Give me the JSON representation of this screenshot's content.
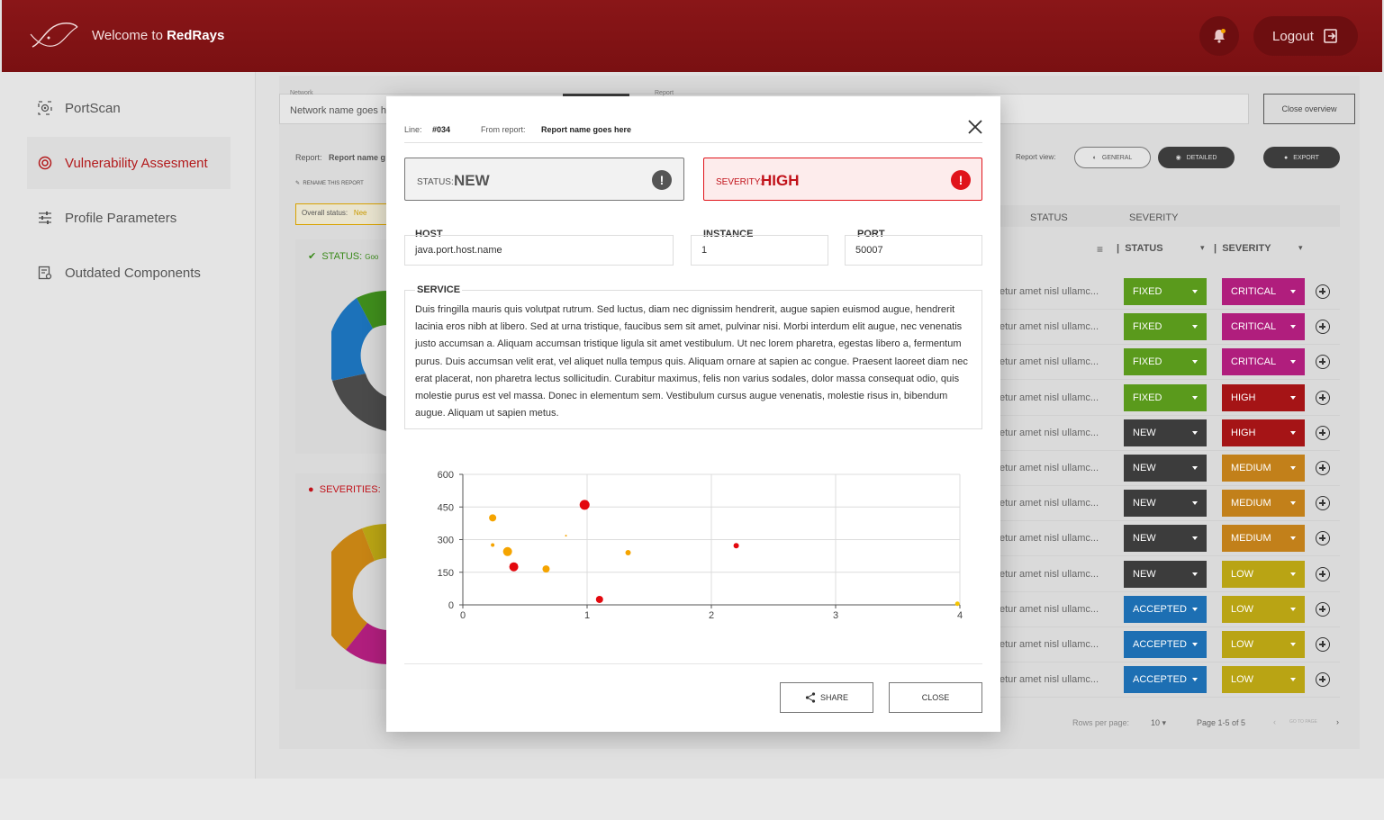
{
  "header": {
    "welcome_prefix": "Welcome to ",
    "brand": "RedRays",
    "logout_label": "Logout"
  },
  "sidebar": {
    "items": [
      {
        "label": "PortScan",
        "icon": "radar-icon",
        "active": false
      },
      {
        "label": "Vulnerability Assesment",
        "icon": "target-icon",
        "active": true
      },
      {
        "label": "Profile Parameters",
        "icon": "sliders-icon",
        "active": false
      },
      {
        "label": "Outdated Components",
        "icon": "components-icon",
        "active": false
      }
    ]
  },
  "background": {
    "network_label": "Network",
    "network_value": "Network name goes h",
    "report_label": "Report",
    "close_overview": "Close overview",
    "report_prefix": "Report:",
    "report_name": "Report name g",
    "rename": "RENAME THIS REPORT",
    "overall_status_label": "Overall status:",
    "overall_status_value": "Nee",
    "report_view_label": "Report view:",
    "view_general": "GENERAL",
    "view_detailed": "DETAILED",
    "export": "EXPORT",
    "status_card_label": "STATUS:",
    "status_card_value": "Goo",
    "severities_card_label": "SEVERITIES:",
    "col_status": "STATUS",
    "col_severity": "SEVERITY",
    "filter_status": "STATUS",
    "filter_severity": "SEVERITY",
    "rows": [
      {
        "text": "etur amet nisl ullamc...",
        "status": "FIXED",
        "severity": "CRITICAL"
      },
      {
        "text": "etur amet nisl ullamc...",
        "status": "FIXED",
        "severity": "CRITICAL"
      },
      {
        "text": "etur amet nisl ullamc...",
        "status": "FIXED",
        "severity": "CRITICAL"
      },
      {
        "text": "etur amet nisl ullamc...",
        "status": "FIXED",
        "severity": "HIGH"
      },
      {
        "text": "etur amet nisl ullamc...",
        "status": "NEW",
        "severity": "HIGH"
      },
      {
        "text": "etur amet nisl ullamc...",
        "status": "NEW",
        "severity": "MEDIUM"
      },
      {
        "text": "etur amet nisl ullamc...",
        "status": "NEW",
        "severity": "MEDIUM"
      },
      {
        "text": "etur amet nisl ullamc...",
        "status": "NEW",
        "severity": "MEDIUM"
      },
      {
        "text": "etur amet nisl ullamc...",
        "status": "NEW",
        "severity": "LOW"
      },
      {
        "text": "etur amet nisl ullamc...",
        "status": "ACCEPTED",
        "severity": "LOW"
      },
      {
        "text": "etur amet nisl ullamc...",
        "status": "ACCEPTED",
        "severity": "LOW"
      },
      {
        "text": "etur amet nisl ullamc...",
        "status": "ACCEPTED",
        "severity": "LOW"
      }
    ],
    "rows_per_page_label": "Rows per page:",
    "rows_per_page": "10",
    "page_info": "Page 1-5 of 5",
    "goto_page": "GO TO PAGE"
  },
  "colors": {
    "brand_red": "#7f1214",
    "fixed": "#5a9a1c",
    "new": "#3c3c3c",
    "accepted": "#1d6fb3",
    "critical": "#b01e7d",
    "high": "#a51416",
    "medium": "#c2801a",
    "low": "#b9a414"
  },
  "modal": {
    "line_label": "Line:",
    "line_value": "#034",
    "report_label": "From report:",
    "report_value": "Report name goes here",
    "status_label": "STATUS:",
    "status_value": "NEW",
    "severity_label": "SEVERITY:",
    "severity_value": "HIGH",
    "host_label": "HOST",
    "host_value": "java.port.host.name",
    "instance_label": "INSTANCE",
    "instance_value": "1",
    "port_label": "PORT",
    "port_value": "50007",
    "service_label": "SERVICE",
    "service_text": "Duis fringilla mauris quis volutpat rutrum. Sed luctus, diam nec dignissim hendrerit, augue sapien euismod augue, hendrerit lacinia eros nibh at libero. Sed at urna tristique, faucibus sem sit amet, pulvinar nisi. Morbi interdum elit augue, nec venenatis justo accumsan a. Aliquam accumsan tristique ligula sit amet vestibulum. Ut nec lorem pharetra, egestas libero a, fermentum purus. Duis accumsan velit erat, vel aliquet nulla tempus quis. Aliquam ornare at sapien ac congue. Praesent laoreet diam nec erat placerat, non pharetra lectus sollicitudin. Curabitur maximus, felis non varius sodales, dolor massa consequat odio, quis molestie purus est vel massa. Donec in elementum sem. Vestibulum cursus augue venenatis, molestie risus in, bibendum augue. Aliquam ut sapien metus.",
    "share_label": "SHARE",
    "close_label": "CLOSE"
  },
  "chart_data": {
    "type": "scatter",
    "title": "",
    "xlabel": "",
    "ylabel": "",
    "xlim": [
      0,
      4
    ],
    "ylim": [
      0,
      600
    ],
    "x_ticks": [
      "0",
      "1",
      "2",
      "3",
      "4"
    ],
    "y_ticks": [
      "0",
      "150",
      "300",
      "450",
      "600"
    ],
    "grid": true,
    "points": [
      {
        "x": 0.24,
        "y": 400,
        "size": 4,
        "color": "#f5a400"
      },
      {
        "x": 0.24,
        "y": 275,
        "size": 2,
        "color": "#f5a400"
      },
      {
        "x": 0.36,
        "y": 245,
        "size": 5,
        "color": "#f5a400"
      },
      {
        "x": 0.41,
        "y": 175,
        "size": 5,
        "color": "#e3080e"
      },
      {
        "x": 0.67,
        "y": 165,
        "size": 4,
        "color": "#f5a400"
      },
      {
        "x": 0.83,
        "y": 318,
        "size": 1,
        "color": "#f5a400"
      },
      {
        "x": 0.98,
        "y": 460,
        "size": 5.5,
        "color": "#e3080e"
      },
      {
        "x": 1.1,
        "y": 25,
        "size": 4,
        "color": "#e3080e"
      },
      {
        "x": 1.33,
        "y": 240,
        "size": 3,
        "color": "#f5a400"
      },
      {
        "x": 2.2,
        "y": 272,
        "size": 3,
        "color": "#e3080e"
      },
      {
        "x": 3.98,
        "y": 5,
        "size": 2.5,
        "color": "#f5c400"
      }
    ]
  }
}
